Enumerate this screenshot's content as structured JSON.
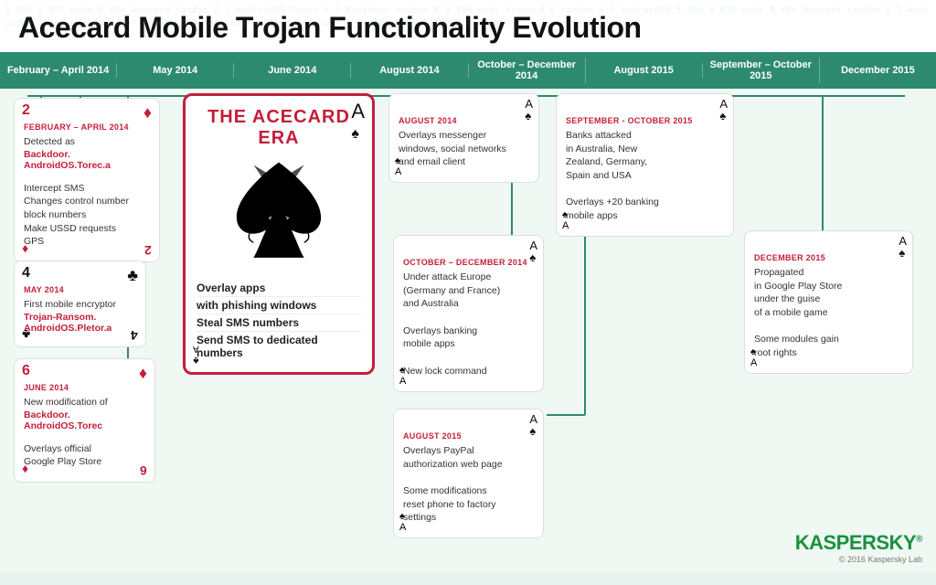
{
  "title": "Acecard Mobile Trojan Functionality Evolution",
  "timeline_headers": [
    "February – April 2014",
    "May 2014",
    "June 2014",
    "August 2014",
    "October – December 2014",
    "August 2015",
    "September – October 2015",
    "December 2015"
  ],
  "cards": {
    "feb_apr_2014": {
      "date": "FEBRUARY – APRIL 2014",
      "number": "2",
      "suit": "♦",
      "suit_color": "red",
      "lines": [
        "Detected as",
        "Backdoor.",
        "AndroidOS.Torec.a",
        "",
        "Intercept SMS",
        "Changes control number",
        "block numbers",
        "Make USSD requests",
        "GPS"
      ],
      "link_text": "Backdoor.\nAndroidOS.Torec.a"
    },
    "may_2014": {
      "date": "MAY 2014",
      "number": "4",
      "suit": "♣",
      "suit_color": "black",
      "lines": [
        "First mobile encryptor",
        "Trojan-Ransom.",
        "AndroidOS.Pletor.a"
      ],
      "link_text": "Trojan-Ransom.\nAndroidOS.Pletor.a"
    },
    "june_2014": {
      "date": "JUNE 2014",
      "number": "6",
      "suit": "♦",
      "suit_color": "red",
      "lines": [
        "New modification of",
        "Backdoor.",
        "AndroidOS.Torec",
        "",
        "Overlays official",
        "Google Play Store"
      ],
      "link_text": "Backdoor.\nAndroidOS.Torec"
    },
    "center": {
      "title": "THE ACECARD ERA",
      "features": [
        "Overlay apps",
        "with phishing windows",
        "Steal SMS numbers",
        "Send SMS to dedicated numbers"
      ]
    },
    "aug_2014": {
      "date": "AUGUST 2014",
      "suit": "♠",
      "suit_color": "black",
      "lines": [
        "Overlays messenger",
        "windows, social networks",
        "and email client"
      ]
    },
    "oct_dec_2014": {
      "date": "OCTOBER – DECEMBER 2014",
      "suit": "♠",
      "suit_color": "black",
      "lines": [
        "Under attack Europe",
        "(Germany and France)",
        "and Australia",
        "",
        "Overlays banking",
        "mobile apps",
        "",
        "New lock command"
      ]
    },
    "aug_2015": {
      "date": "AUGUST 2015",
      "suit": "♠",
      "suit_color": "black",
      "lines": [
        "Overlays PayPal",
        "authorization web page",
        "",
        "Some modifications",
        "reset phone to factory",
        "settings"
      ]
    },
    "sep_oct_2015": {
      "date": "SEPTEMBER - OCTOBER 2015",
      "suit": "♠",
      "suit_color": "black",
      "lines": [
        "Banks attacked",
        "in Australia, New",
        "Zealand, Germany,",
        "Spain and USA",
        "",
        "Overlays +20 banking",
        "mobile apps"
      ]
    },
    "dec_2015": {
      "date": "DECEMBER 2015",
      "suit": "♠",
      "suit_color": "black",
      "lines": [
        "Propagated",
        "in Google Play Store",
        "under the guise",
        "of a mobile game",
        "",
        "Some modules gain",
        "root rights"
      ]
    }
  },
  "kaspersky": {
    "logo": "KASPERSKY",
    "superscript": "®",
    "copyright": "© 2016 Kaspersky Lab"
  }
}
